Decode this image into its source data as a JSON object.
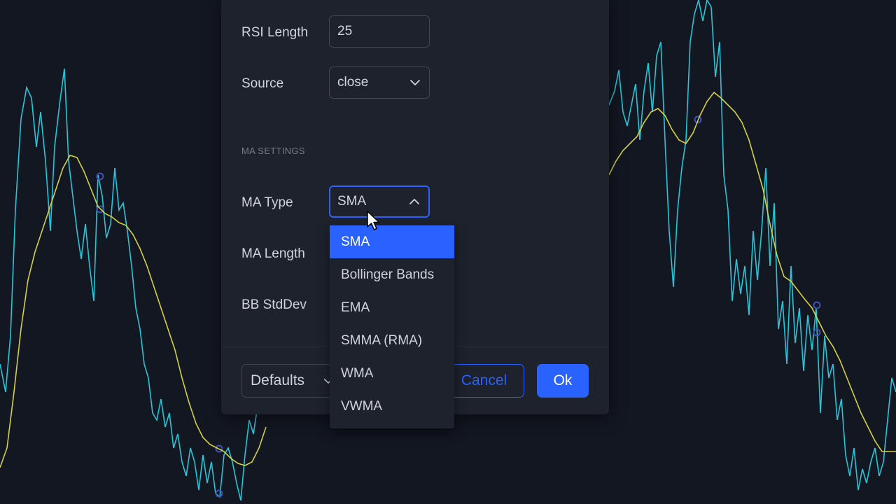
{
  "colors": {
    "background": "#131722",
    "dialog": "#1e222d",
    "accent": "#2962ff",
    "text": "#d1d4dc",
    "muted": "#787b86",
    "rsi_line": "#26c6da",
    "ma_line": "#d4d046",
    "marker": "#3f51b5"
  },
  "dialog": {
    "rows": {
      "rsi_length": {
        "label": "RSI Length",
        "value": "25"
      },
      "source": {
        "label": "Source",
        "value": "close"
      },
      "ma_type": {
        "label": "MA Type",
        "value": "SMA"
      },
      "ma_length": {
        "label": "MA Length"
      },
      "bb_stddev": {
        "label": "BB StdDev"
      }
    },
    "section_ma": "MA SETTINGS",
    "footer": {
      "defaults_label": "Defaults",
      "cancel_label": "Cancel",
      "ok_label": "Ok"
    }
  },
  "dropdown": {
    "selected": "SMA",
    "options": [
      "SMA",
      "Bollinger Bands",
      "EMA",
      "SMMA (RMA)",
      "WMA",
      "VWMA"
    ]
  },
  "icons": {
    "source_chevron": "chevron-down-icon",
    "ma_type_chevron": "chevron-up-icon",
    "defaults_chevron": "chevron-down-icon",
    "cursor": "mouse-pointer-icon"
  }
}
